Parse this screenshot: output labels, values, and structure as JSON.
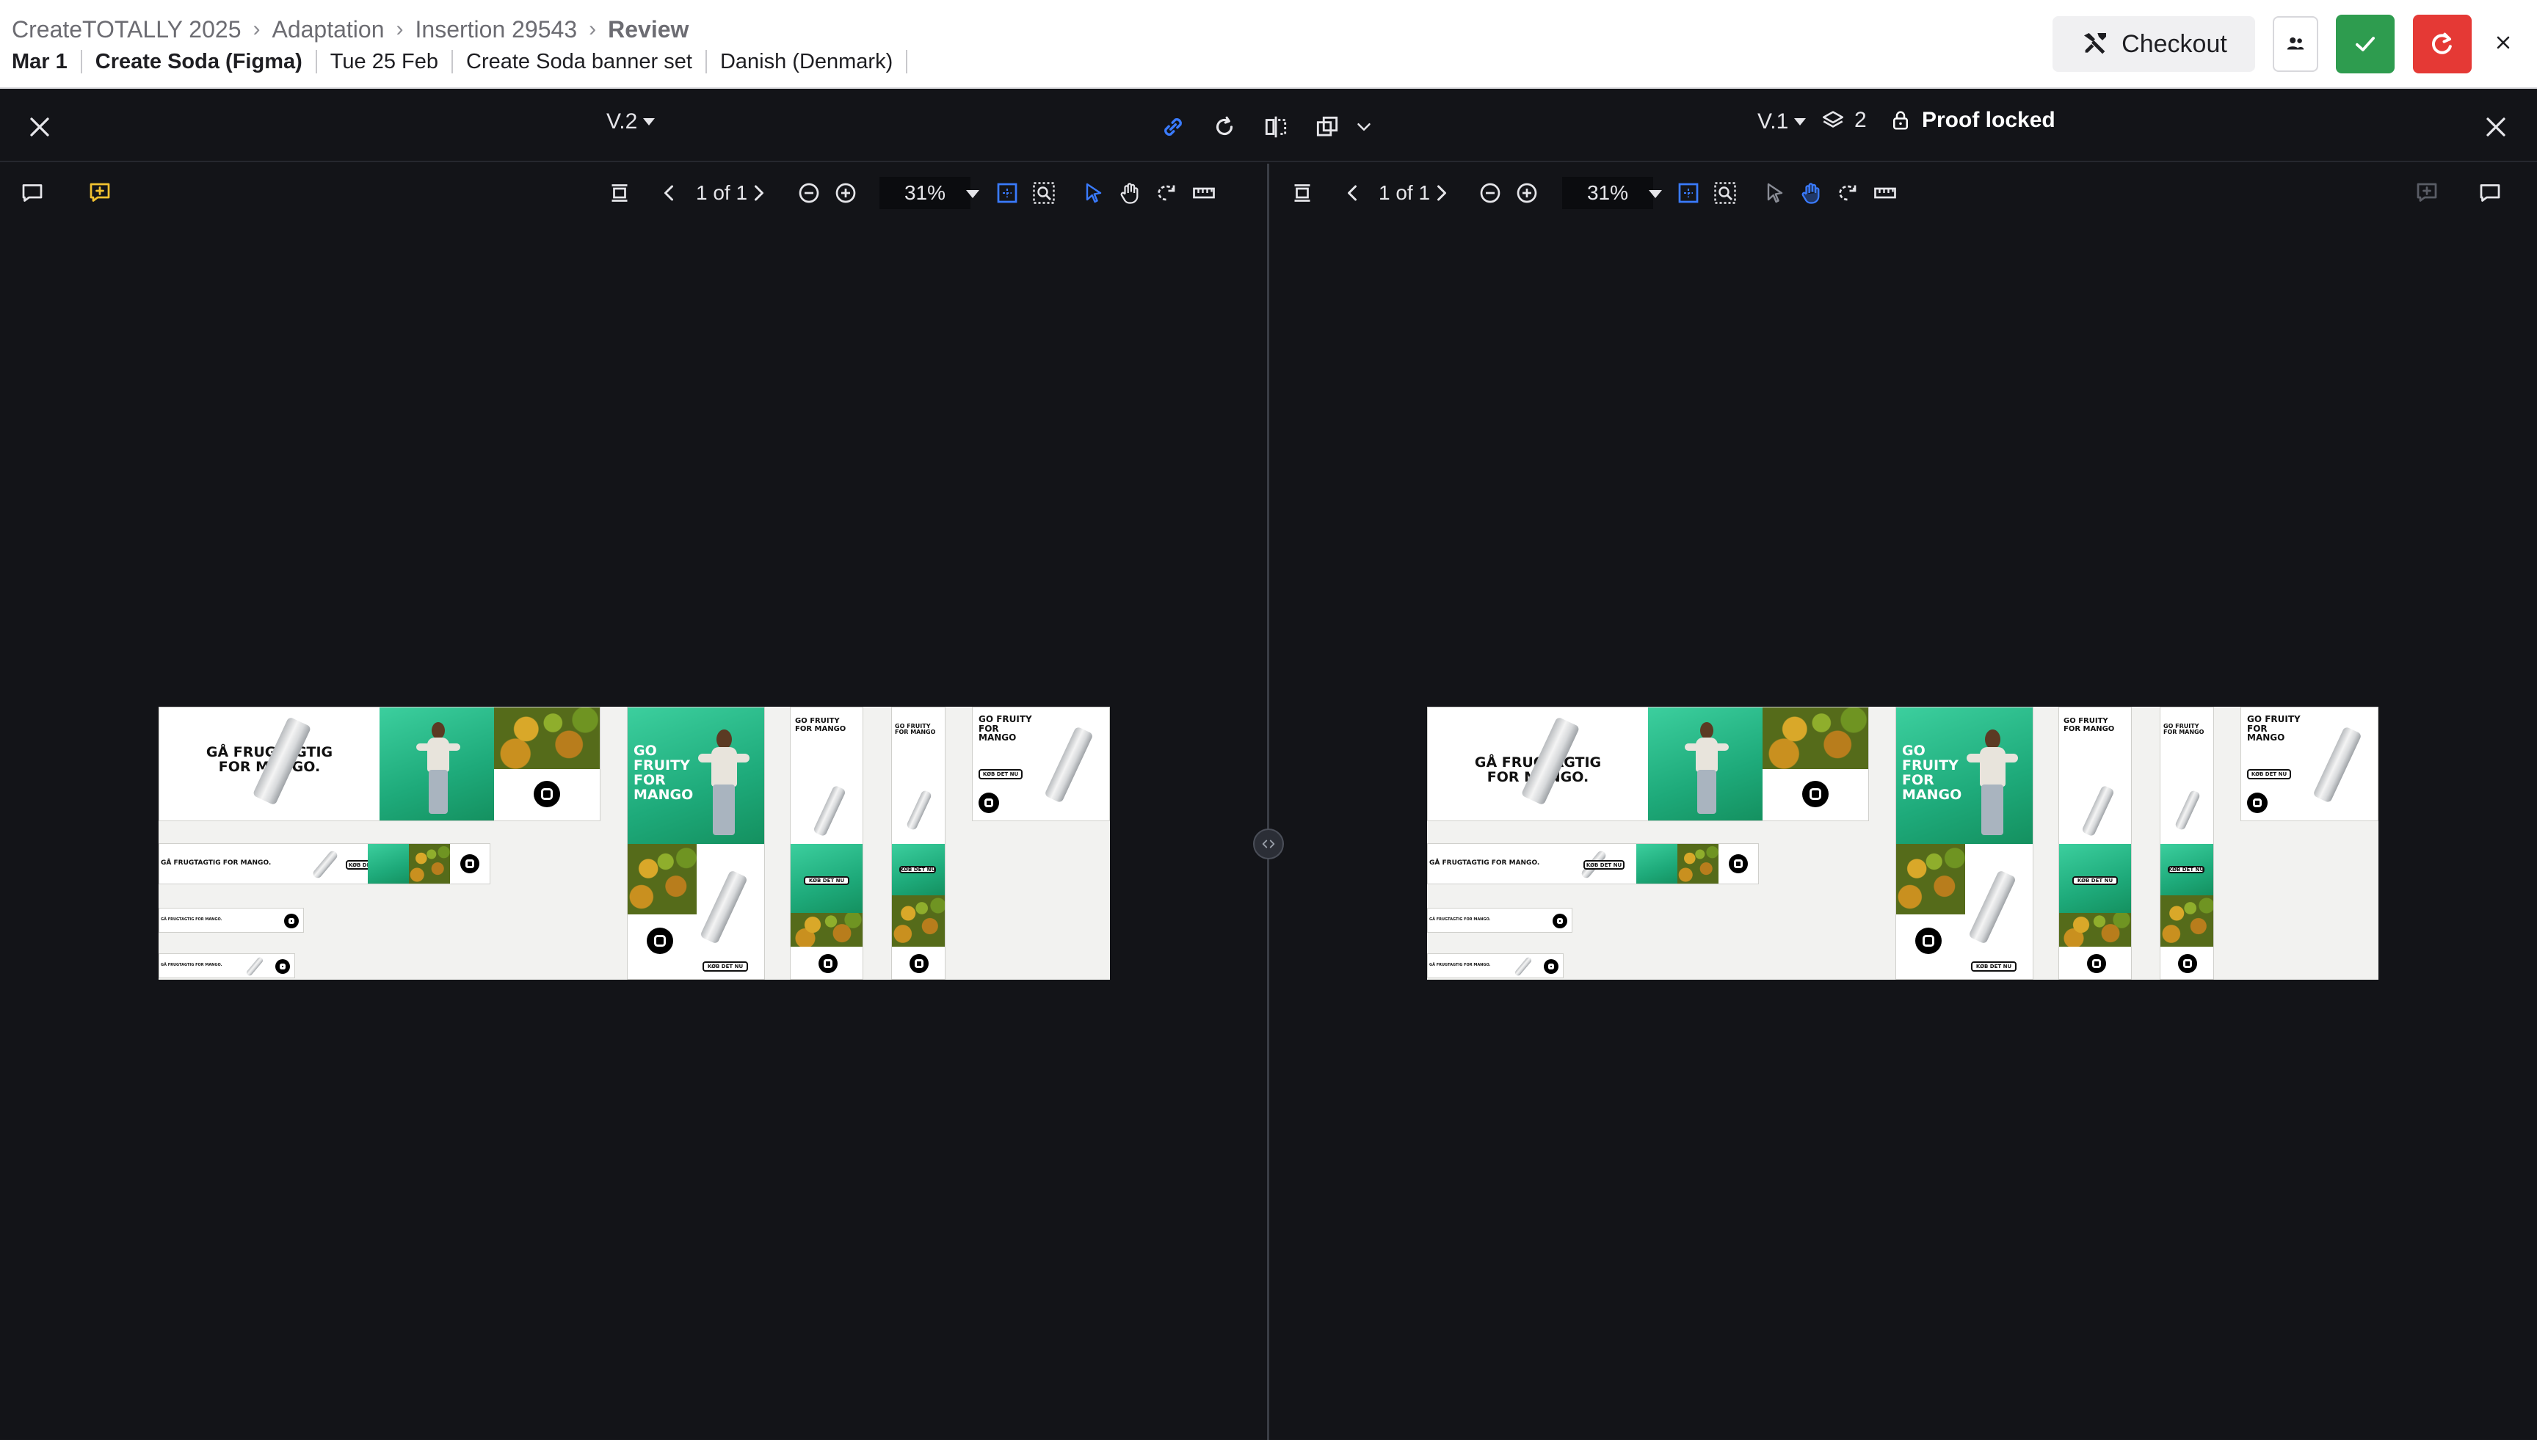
{
  "header": {
    "breadcrumb": [
      "CreateTOTALLY 2025",
      "Adaptation",
      "Insertion 29543",
      "Review"
    ],
    "meta": {
      "date_short": "Mar 1",
      "job_name": "Create Soda (Figma)",
      "due_date": "Tue 25 Feb",
      "campaign": "Create Soda banner set",
      "language": "Danish (Denmark)"
    },
    "checkout_label": "Checkout",
    "close_symbol": "×",
    "buttons": {
      "people_icon": "people-icon",
      "approve_color": "#2e9c4f",
      "reject_color": "#e53935"
    }
  },
  "viewer": {
    "left": {
      "version": "V.2",
      "page": "1 of 1",
      "zoom": "31%"
    },
    "right": {
      "version": "V.1",
      "layers_count": "2",
      "proof_status": "Proof locked",
      "page": "1 of 1",
      "zoom": "31%"
    },
    "accent_color": "#3a7bff",
    "comment_icon_color": "#f2c230"
  },
  "artboard": {
    "headline_da": "GÅ FRUGTAGTIG FOR MANGO.",
    "headline_da_small": "GÅ FRUGTAGTIG FOR MANGO.",
    "headline_en": "GO FRUITY FOR MANGO",
    "cta": "KØB DET NU"
  }
}
